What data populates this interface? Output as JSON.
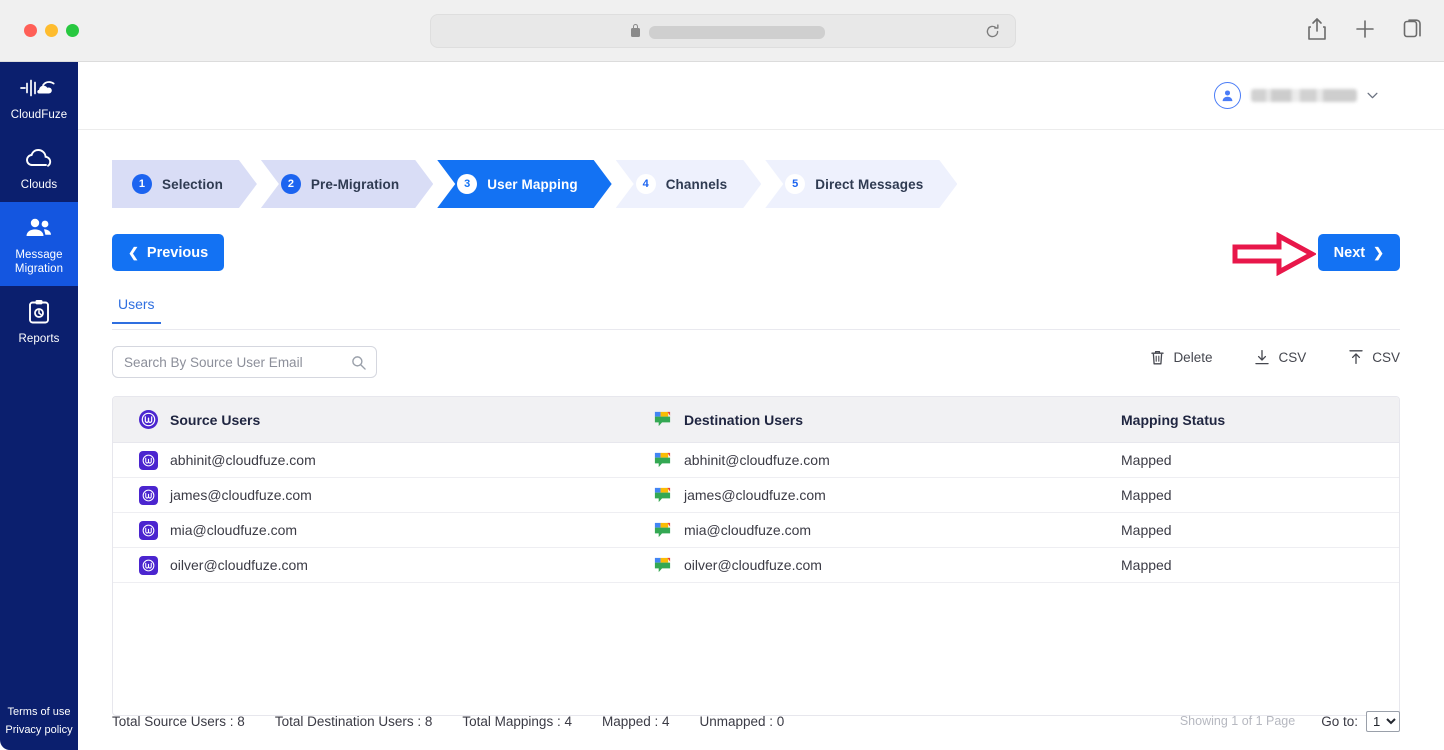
{
  "browser": {
    "traffic_lights": [
      "close",
      "minimize",
      "zoom"
    ],
    "url_value": "",
    "lock_icon": "lock-icon",
    "reload_icon": "reload-icon",
    "right_icons": [
      "share-icon",
      "new-tab-icon",
      "tab-overview-icon"
    ]
  },
  "sidebar": {
    "brand": "CloudFuze",
    "items": [
      {
        "label": "Clouds",
        "icon": "cloud-icon",
        "active": false
      },
      {
        "label": "Message Migration",
        "icon": "users-icon",
        "active": true
      },
      {
        "label": "Reports",
        "icon": "clipboard-icon",
        "active": false
      }
    ],
    "legal": [
      "Terms of use",
      "Privacy policy"
    ]
  },
  "topbar": {
    "user_name": "",
    "avatar_icon": "user-avatar-icon",
    "caret_icon": "chevron-down-icon"
  },
  "wizard": {
    "steps": [
      {
        "num": "1",
        "label": "Selection",
        "state": "done"
      },
      {
        "num": "2",
        "label": "Pre-Migration",
        "state": "done"
      },
      {
        "num": "3",
        "label": "User Mapping",
        "state": "active"
      },
      {
        "num": "4",
        "label": "Channels",
        "state": "todo"
      },
      {
        "num": "5",
        "label": "Direct Messages",
        "state": "todo"
      }
    ]
  },
  "nav": {
    "previous_label": "Previous",
    "next_label": "Next",
    "prev_chevron": "❮",
    "next_chevron": "❯",
    "annotation": "red-arrow-pointing-to-next"
  },
  "tabs": [
    {
      "label": "Users",
      "active": true
    }
  ],
  "toolbar": {
    "search_placeholder": "Search By Source User Email",
    "search_value": "",
    "actions": [
      {
        "label": "Delete",
        "icon": "trash-icon"
      },
      {
        "label": "CSV",
        "icon": "download-icon"
      },
      {
        "label": "CSV",
        "icon": "upload-icon"
      }
    ]
  },
  "table": {
    "columns": [
      {
        "label": "Source Users",
        "icon": "workplace-icon"
      },
      {
        "label": "Destination Users",
        "icon": "google-chat-icon"
      },
      {
        "label": "Mapping Status",
        "icon": ""
      }
    ],
    "rows": [
      {
        "source": "abhinit@cloudfuze.com",
        "destination": "abhinit@cloudfuze.com",
        "status": "Mapped"
      },
      {
        "source": "james@cloudfuze.com",
        "destination": "james@cloudfuze.com",
        "status": "Mapped"
      },
      {
        "source": "mia@cloudfuze.com",
        "destination": "mia@cloudfuze.com",
        "status": "Mapped"
      },
      {
        "source": "oilver@cloudfuze.com",
        "destination": "oilver@cloudfuze.com",
        "status": "Mapped"
      }
    ]
  },
  "footer": {
    "stats": [
      "Total Source Users : 8",
      "Total Destination Users : 8",
      "Total Mappings : 4",
      "Mapped : 4",
      "Unmapped : 0"
    ],
    "showing": "Showing 1 of 1 Page",
    "goto_label": "Go to:",
    "goto_value": "1",
    "goto_options": [
      "1"
    ]
  },
  "colors": {
    "brand_navy": "#0b1f6e",
    "accent_blue": "#1372f3",
    "step_done_bg": "#d9ddf6",
    "step_todo_bg": "#eef1fd",
    "annotation_red": "#e8174a",
    "workplace_purple": "#4b25cf"
  }
}
